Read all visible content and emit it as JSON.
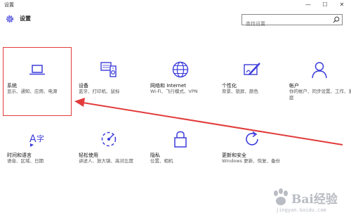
{
  "window": {
    "title": "设置",
    "minimize": "—",
    "maximize": "☐",
    "close": "✕"
  },
  "header": {
    "title": "设置",
    "search_placeholder": "查找设置"
  },
  "accent": "#3c3cdc",
  "highlight_color": "#e23b3b",
  "tiles": [
    {
      "name": "系统",
      "desc": "显示、通知、应用、电源",
      "icon": "laptop-icon"
    },
    {
      "name": "设备",
      "desc": "蓝牙、打印机、鼠标",
      "icon": "devices-icon"
    },
    {
      "name": "网络和 Internet",
      "desc": "Wi-Fi、飞行模式、VPN",
      "icon": "globe-icon"
    },
    {
      "name": "个性化",
      "desc": "背景、锁屏、颜色",
      "icon": "personalization-icon"
    },
    {
      "name": "帐户",
      "desc": "你的帐户、同步设置、工作、家庭",
      "icon": "account-icon"
    },
    {
      "name": "时间和语言",
      "desc": "语音、区域、日期",
      "icon": "time-language-icon"
    },
    {
      "name": "轻松使用",
      "desc": "讲述人、放大镜、高对比度",
      "icon": "ease-of-access-icon"
    },
    {
      "name": "隐私",
      "desc": "位置、相机",
      "icon": "lock-icon"
    },
    {
      "name": "更新和安全",
      "desc": "Windows 更新、恢复、备份",
      "icon": "update-icon"
    }
  ],
  "watermark": {
    "brand": "Bai经验",
    "url": "jingyan.baidu.com"
  }
}
